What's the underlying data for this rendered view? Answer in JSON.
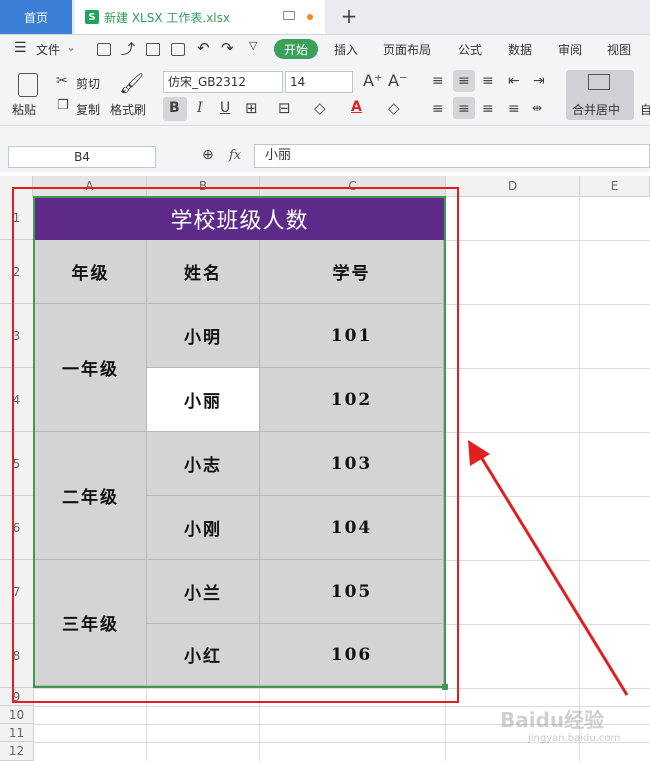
{
  "tabs": {
    "home": "首页",
    "doc_icon": "S",
    "doc_title": "新建 XLSX 工作表.xlsx",
    "plus": "+"
  },
  "menu": {
    "file": "文件",
    "items": [
      "开始",
      "插入",
      "页面布局",
      "公式",
      "数据",
      "审阅",
      "视图"
    ]
  },
  "ribbon": {
    "paste": "粘贴",
    "cut": "剪切",
    "copy": "复制",
    "format_painter": "格式刷",
    "font_name": "仿宋_GB2312",
    "font_size": "14",
    "bold": "B",
    "italic": "I",
    "underline": "U",
    "merge_center": "合并居中",
    "auto": "自"
  },
  "formula_bar": {
    "name_box": "B4",
    "fx": "fx",
    "value": "小丽"
  },
  "columns": [
    "A",
    "B",
    "C",
    "D",
    "E"
  ],
  "rows": [
    "1",
    "2",
    "3",
    "4",
    "5",
    "6",
    "7",
    "8",
    "9",
    "10",
    "11",
    "12"
  ],
  "sheet": {
    "title": "学校班级人数",
    "headers": [
      "年级",
      "姓名",
      "学号"
    ],
    "grades": [
      "一年级",
      "二年级",
      "三年级"
    ],
    "names": [
      "小明",
      "小丽",
      "小志",
      "小刚",
      "小兰",
      "小红"
    ],
    "ids": [
      "101",
      "102",
      "103",
      "104",
      "105",
      "106"
    ]
  },
  "watermark": {
    "main": "Baidu经验",
    "sub": "jingyan.baidu.com"
  },
  "colors": {
    "start_tab": "#3aa05c",
    "title_fill": "#5e2a8a",
    "home_tab": "#3c7fd6",
    "annotation": "#e02020"
  }
}
